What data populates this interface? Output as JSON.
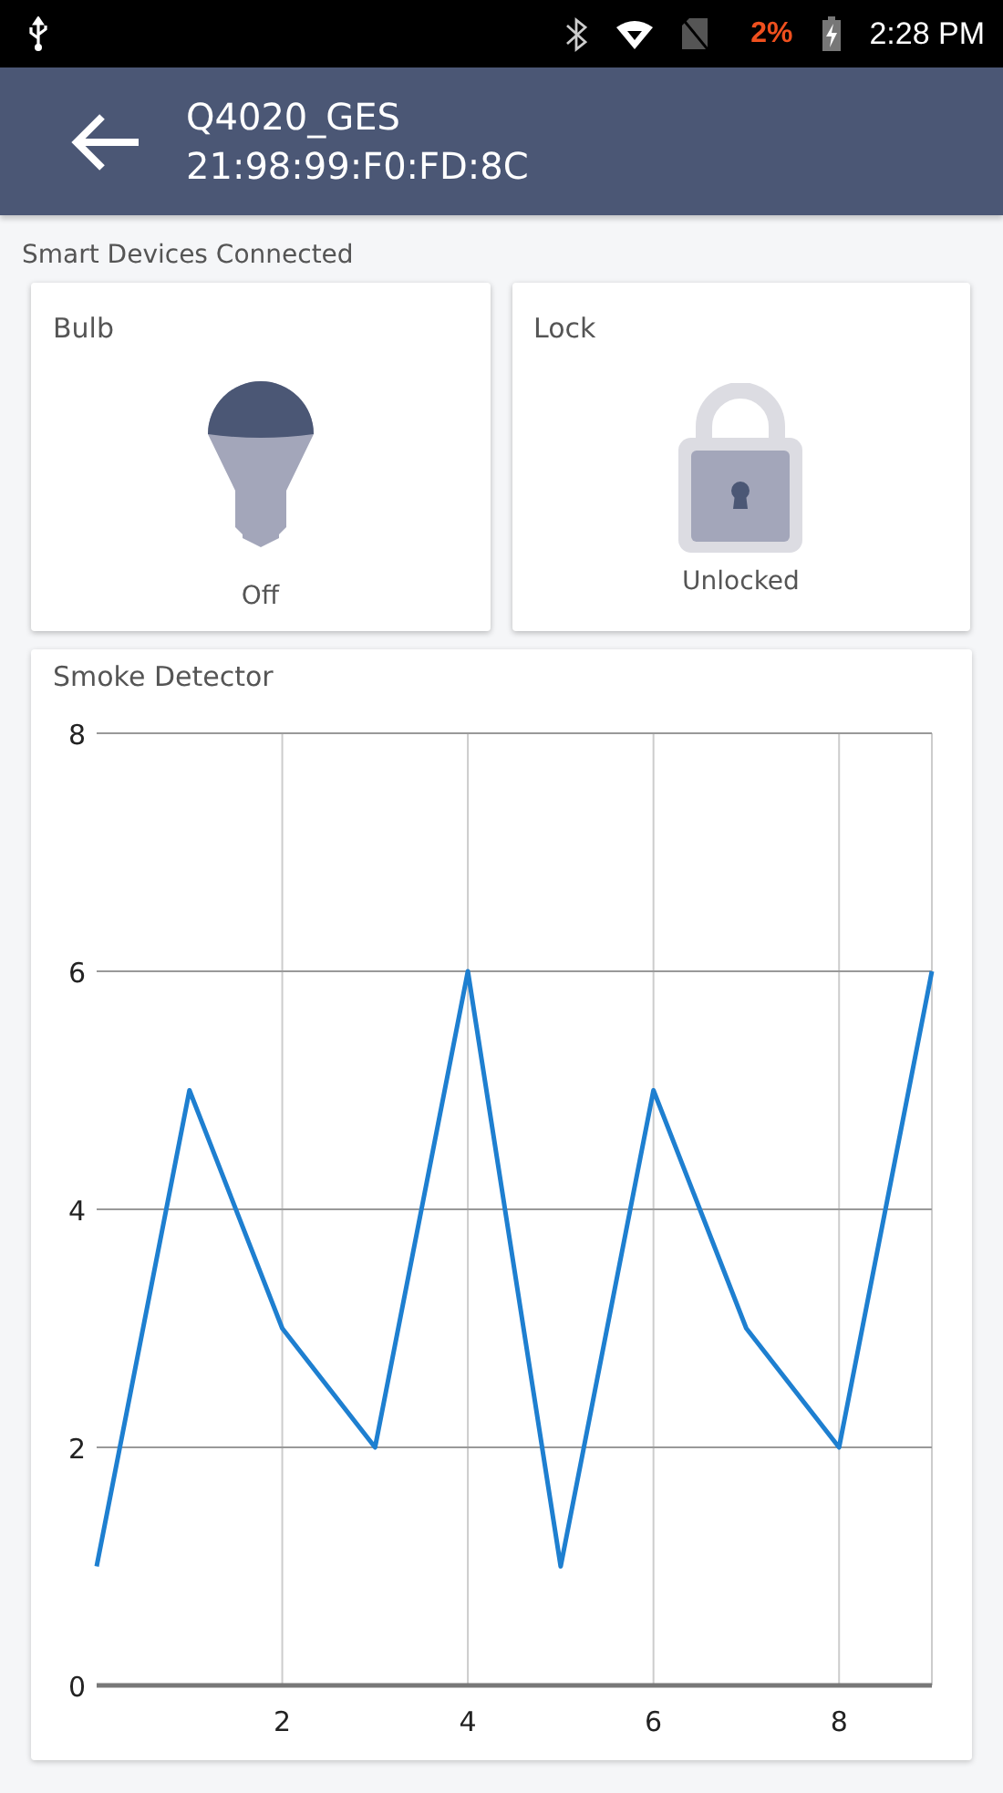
{
  "status_bar": {
    "battery_percent": "2%",
    "time": "2:28 PM"
  },
  "header": {
    "title": "Q4020_GES",
    "subtitle": "21:98:99:F0:FD:8C"
  },
  "section_title": "Smart Devices Connected",
  "devices": [
    {
      "kind": "bulb",
      "name": "Bulb",
      "status": "Off",
      "on": false
    },
    {
      "kind": "lock",
      "name": "Lock",
      "status": "Unlocked",
      "locked": false
    }
  ],
  "smoke_detector": {
    "title": "Smoke Detector",
    "chart_data": {
      "type": "line",
      "grid": true,
      "x": [
        0,
        1,
        2,
        3,
        4,
        5,
        6,
        7,
        8,
        9
      ],
      "xlim": [
        0,
        9
      ],
      "ylim": [
        0,
        8
      ],
      "xticks": [
        2,
        4,
        6,
        8
      ],
      "yticks": [
        0,
        2,
        4,
        6,
        8
      ],
      "series": [
        {
          "color": "#1e7fd0",
          "values": [
            1,
            5,
            3,
            2,
            6,
            1,
            5,
            3,
            2,
            6
          ]
        }
      ]
    }
  }
}
